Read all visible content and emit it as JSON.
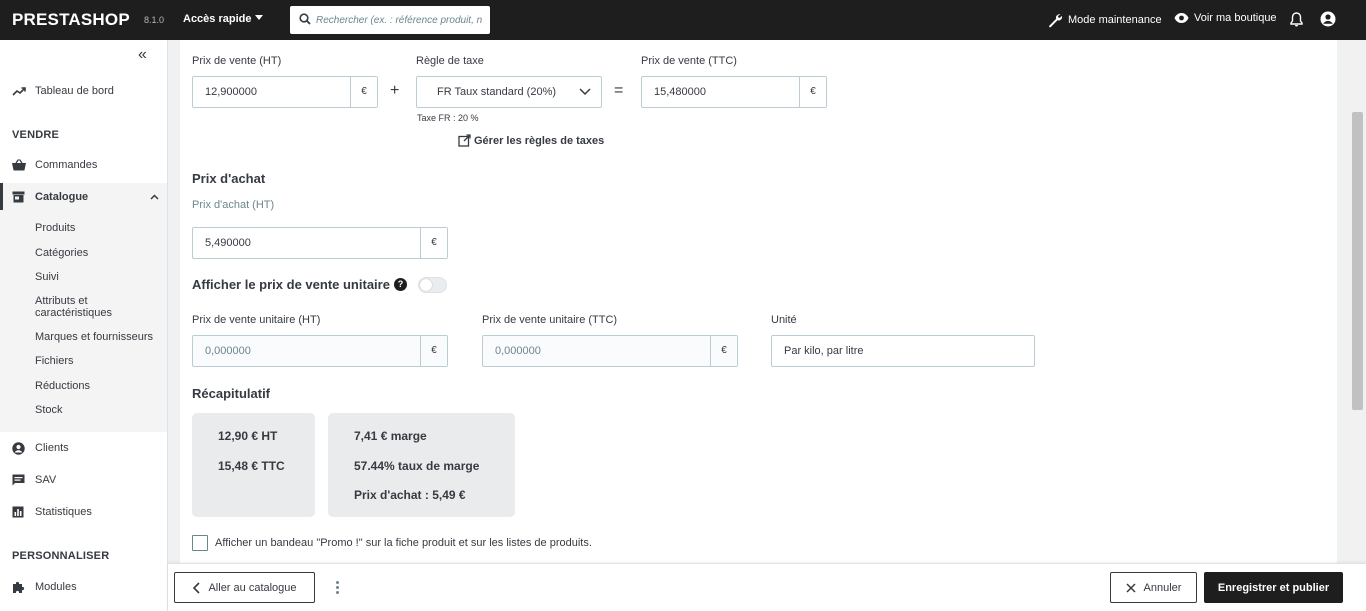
{
  "topbar": {
    "logo": "PRESTASHOP",
    "version": "8.1.0",
    "quick_access": "Accès rapide",
    "search_placeholder": "Rechercher (ex. : référence produit, n",
    "maintenance": "Mode maintenance",
    "view_shop": "Voir ma boutique"
  },
  "sidebar": {
    "dashboard": "Tableau de bord",
    "section_sell": "VENDRE",
    "orders": "Commandes",
    "catalog": "Catalogue",
    "catalog_sub": [
      "Produits",
      "Catégories",
      "Suivi",
      "Attributs et caractéristiques",
      "Marques et fournisseurs",
      "Fichiers",
      "Réductions",
      "Stock"
    ],
    "customers": "Clients",
    "sav": "SAV",
    "stats": "Statistiques",
    "section_customize": "PERSONNALISER",
    "modules": "Modules"
  },
  "pricing": {
    "retail_ht_label": "Prix de vente (HT)",
    "retail_ht_value": "12,900000",
    "currency": "€",
    "plus": "+",
    "tax_rule_label": "Règle de taxe",
    "tax_rule_value": "FR Taux standard (20%)",
    "equals": "=",
    "retail_ttc_label": "Prix de vente (TTC)",
    "retail_ttc_value": "15,480000",
    "tax_hint": "Taxe  FR : 20 %",
    "manage_tax_link": "Gérer les règles de taxes"
  },
  "cost": {
    "title": "Prix d'achat",
    "label": "Prix d'achat (HT)",
    "value": "5,490000"
  },
  "unit_price": {
    "title": "Afficher le prix de vente unitaire",
    "help": "?",
    "enabled": false,
    "ht_label": "Prix de vente unitaire (HT)",
    "ht_placeholder": "0,000000",
    "ttc_label": "Prix de vente unitaire (TTC)",
    "ttc_placeholder": "0,000000",
    "unit_label": "Unité",
    "unit_placeholder": "Par kilo, par litre"
  },
  "summary": {
    "title": "Récapitulatif",
    "card1": [
      "12,90 € HT",
      "15,48 € TTC"
    ],
    "card2": [
      "7,41 € marge",
      "57.44% taux de marge",
      "Prix d'achat : 5,49 €"
    ]
  },
  "promo": {
    "checked": false,
    "label": "Afficher un bandeau \"Promo !\" sur la fiche produit et sur les listes de produits."
  },
  "footer": {
    "back": "Aller au catalogue",
    "cancel": "Annuler",
    "save": "Enregistrer et publier"
  }
}
